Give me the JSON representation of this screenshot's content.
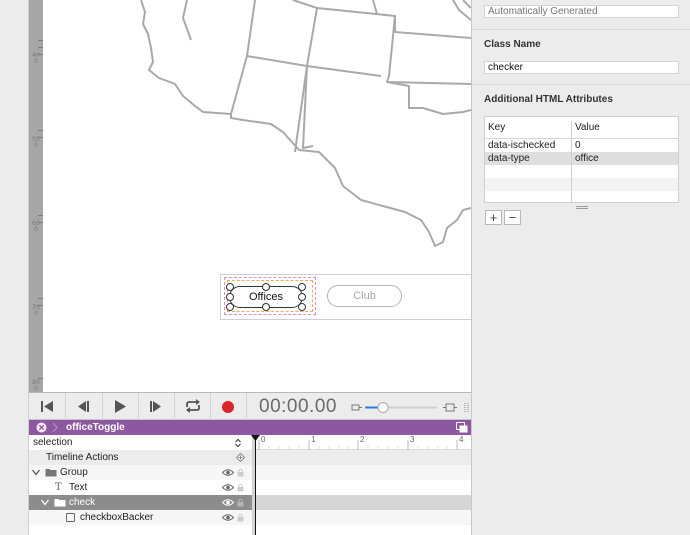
{
  "ruler": {
    "labels": [
      "400",
      "500",
      "600",
      "700",
      "800"
    ]
  },
  "stage": {
    "offices_label": "Offices",
    "club_label": "Club"
  },
  "inspector": {
    "id_placeholder": "Automatically Generated",
    "class_name_heading": "Class Name",
    "class_name_value": "checker",
    "attrs_heading": "Additional HTML Attributes",
    "col_key": "Key",
    "col_value": "Value",
    "rows": [
      {
        "key": "data-ischecked",
        "value": "0"
      },
      {
        "key": "data-type",
        "value": "office"
      }
    ],
    "add_button": "+",
    "remove_button": "−"
  },
  "transport": {
    "timecode": "00:00.00",
    "icons": [
      "skip-to-start-icon",
      "step-back-icon",
      "play-icon",
      "step-forward-icon",
      "loop-icon",
      "record-icon",
      "zoom-slider"
    ],
    "record_color": "#d9262b"
  },
  "timeline": {
    "name": "officeToggle",
    "mode": "selection",
    "ticks": [
      "0",
      "1",
      "2",
      "3",
      "4"
    ],
    "accent": "#8d589f"
  },
  "layers": {
    "timeline_actions": "Timeline Actions",
    "group": "Group",
    "text": "Text",
    "check": "check",
    "checkbox_backer": "checkboxBacker"
  }
}
